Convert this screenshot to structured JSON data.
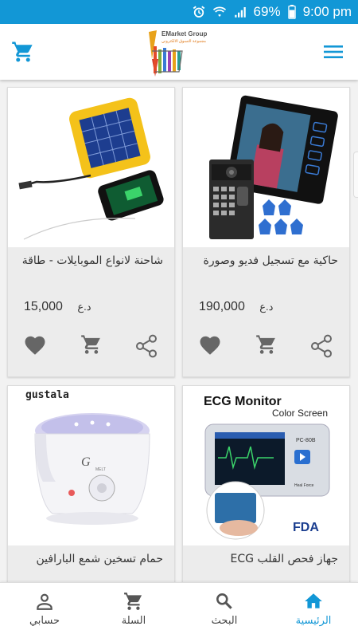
{
  "status_bar": {
    "battery": "69%",
    "time": "9:00 pm"
  },
  "header": {
    "logo_title": "EMarket Group",
    "logo_subtitle": "مجموعة التسوق الالكتروني"
  },
  "products": [
    {
      "title": "حاكية مع تسجيل فديو وصورة",
      "price": "190,000",
      "currency": "د.ع",
      "image": "video-doorphone-image"
    },
    {
      "title": "شاحنة لانواع الموبايلات - طاقة",
      "price": "15,000",
      "currency": "د.ع",
      "image": "solar-charger-image"
    },
    {
      "title": "جهاز فحص القلب ECG",
      "image": "ecg-monitor-image",
      "image_text": {
        "heading": "ECG Monitor",
        "sub": "Color Screen",
        "model": "PC-80B",
        "badge": "FDA",
        "brand": "Heal Force"
      }
    },
    {
      "title": "حمام تسخين شمع البارافين",
      "image": "wax-heater-image",
      "image_text": {
        "brand": "gustala",
        "logo": "G",
        "dial": "MELT"
      }
    }
  ],
  "bottom_nav": [
    {
      "label": "الرئيسية",
      "icon": "home-icon",
      "active": true
    },
    {
      "label": "البحث",
      "icon": "search-icon",
      "active": false
    },
    {
      "label": "السلة",
      "icon": "cart-icon",
      "active": false
    },
    {
      "label": "حسابي",
      "icon": "person-icon",
      "active": false
    }
  ],
  "colors": {
    "primary": "#1297d6",
    "card": "#ececec",
    "icon_gray": "#666666"
  }
}
